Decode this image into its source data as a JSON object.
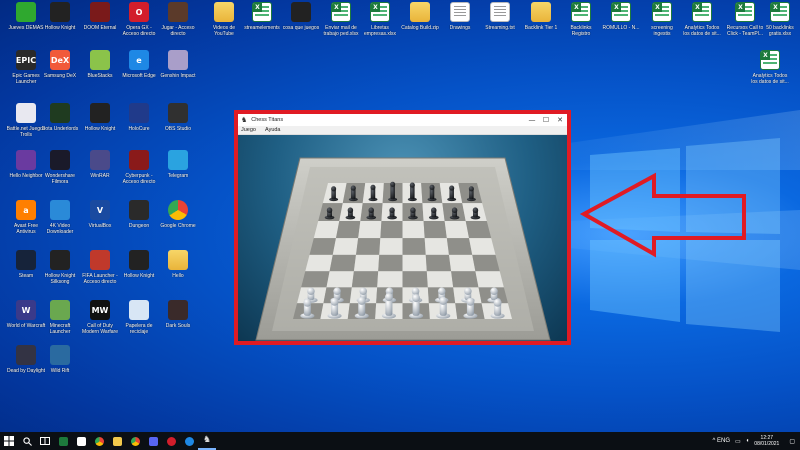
{
  "desktop": {
    "icons": [
      {
        "label": "Jueves DEMAS",
        "glyph": "",
        "bg": "#2fa82f"
      },
      {
        "label": "Hollow Knight",
        "glyph": "",
        "bg": "#222222"
      },
      {
        "label": "DOOM Eternal",
        "glyph": "",
        "bg": "#7a1a1a"
      },
      {
        "label": "Opera GX - Acceso directo",
        "glyph": "O",
        "bg": "#d21e2b"
      },
      {
        "label": "Jugar - Acceso directo",
        "glyph": "",
        "bg": "#5b3a2a"
      },
      {
        "label": "Videos de YouTube",
        "glyph": "",
        "bg": "folder"
      },
      {
        "label": "streamelements",
        "glyph": "",
        "bg": "sheet"
      },
      {
        "label": "cosa que juegos",
        "glyph": "",
        "bg": "#222222"
      },
      {
        "label": "Enviar mail de trabajo ped.xlsx",
        "glyph": "",
        "bg": "sheet"
      },
      {
        "label": "Libretas empresas.xlsx",
        "glyph": "",
        "bg": "sheet"
      },
      {
        "label": "Catalog Build.zip",
        "glyph": "",
        "bg": "folder"
      },
      {
        "label": "Drawings",
        "glyph": "",
        "bg": "doc"
      },
      {
        "label": "Streaming.txt",
        "glyph": "",
        "bg": "doc"
      },
      {
        "label": "Backlink Tier 1",
        "glyph": "",
        "bg": "folder"
      },
      {
        "label": "Backlinks Registro",
        "glyph": "",
        "bg": "sheet"
      },
      {
        "label": "ROMULLO - N...",
        "glyph": "",
        "bg": "sheet"
      },
      {
        "label": "screening ingestis",
        "glyph": "",
        "bg": "sheet"
      },
      {
        "label": "Analytics Todos los datos de sit...",
        "glyph": "",
        "bg": "sheet"
      },
      {
        "label": "Recursos Call to Click - TeamPl...",
        "glyph": "",
        "bg": "sheet"
      },
      {
        "label": "50 backlinks gratis.xlsx",
        "glyph": "",
        "bg": "sheet"
      },
      {
        "label": "Epic Games Launcher",
        "glyph": "EPIC",
        "bg": "#2a2a2a"
      },
      {
        "label": "Samsung DeX",
        "glyph": "DeX",
        "bg": "#f15a3a"
      },
      {
        "label": "BlueStacks",
        "glyph": "",
        "bg": "#8bc34a"
      },
      {
        "label": "Microsoft Edge",
        "glyph": "e",
        "bg": "#1e88e5"
      },
      {
        "label": "Genshin Impact",
        "glyph": "",
        "bg": "#a99ec9"
      },
      {
        "label": "Analytics Todos los datos de sit...",
        "glyph": "",
        "bg": "sheet"
      },
      {
        "label": "Battle.net Juegos Trolls",
        "glyph": "",
        "bg": "#e8e8f0"
      },
      {
        "label": "Dota Underlords",
        "glyph": "",
        "bg": "#1f3b20"
      },
      {
        "label": "Hollow Knight",
        "glyph": "",
        "bg": "#222222"
      },
      {
        "label": "HoloCure",
        "glyph": "",
        "bg": "#203a8a"
      },
      {
        "label": "OBS Studio",
        "glyph": "",
        "bg": "#303030"
      },
      {
        "label": "Hello Neighbor",
        "glyph": "",
        "bg": "#6a3aa0"
      },
      {
        "label": "Wondershare Filmora",
        "glyph": "",
        "bg": "#1a1a2a"
      },
      {
        "label": "WinRAR",
        "glyph": "",
        "bg": "#4a4a8a"
      },
      {
        "label": "Cyberpunk - Acceso directo",
        "glyph": "",
        "bg": "#8a1a1a"
      },
      {
        "label": "Telegram",
        "glyph": "",
        "bg": "#2aa3e0"
      },
      {
        "label": "Avast Free Antivirus",
        "glyph": "a",
        "bg": "#ff7f00"
      },
      {
        "label": "4K Video Downloader",
        "glyph": "",
        "bg": "#2a8ad8"
      },
      {
        "label": "VirtualBox",
        "glyph": "V",
        "bg": "#1a4aa0"
      },
      {
        "label": "Dungeon",
        "glyph": "",
        "bg": "#2a2a2a"
      },
      {
        "label": "Google Chrome",
        "glyph": "",
        "bg": "chrome"
      },
      {
        "label": "Steam",
        "glyph": "",
        "bg": "#16233a"
      },
      {
        "label": "Hollow Knight Silksong",
        "glyph": "",
        "bg": "#222222"
      },
      {
        "label": "FIFA Launcher - Acceso directo",
        "glyph": "",
        "bg": "#c0392b"
      },
      {
        "label": "Hollow Knight",
        "glyph": "",
        "bg": "#222222"
      },
      {
        "label": "Hello",
        "glyph": "",
        "bg": "folder"
      },
      {
        "label": "World of Warcraft",
        "glyph": "W",
        "bg": "#3a3a8a"
      },
      {
        "label": "Minecraft Launcher",
        "glyph": "",
        "bg": "#6aa84f"
      },
      {
        "label": "Call of Duty Modern Warfare",
        "glyph": "MW",
        "bg": "#111111"
      },
      {
        "label": "Papelera de reciclaje",
        "glyph": "",
        "bg": "#d8e6f5"
      },
      {
        "label": "Dark Souls",
        "glyph": "",
        "bg": "#3a2a2a"
      },
      {
        "label": "Dead by Daylight",
        "glyph": "",
        "bg": "#333344"
      },
      {
        "label": "Wild Rift",
        "glyph": "",
        "bg": "#2a6aa0"
      }
    ]
  },
  "window": {
    "title": "Chess Titans",
    "controls": {
      "minimize": "—",
      "maximize": "☐",
      "close": "✕"
    },
    "menu": [
      "Juego",
      "Ayuda"
    ]
  },
  "arrow": {
    "color": "#e01b24"
  },
  "taskbar": {
    "tray_text": "^  ENG",
    "time": "12:27",
    "date": "08/01/2021"
  }
}
